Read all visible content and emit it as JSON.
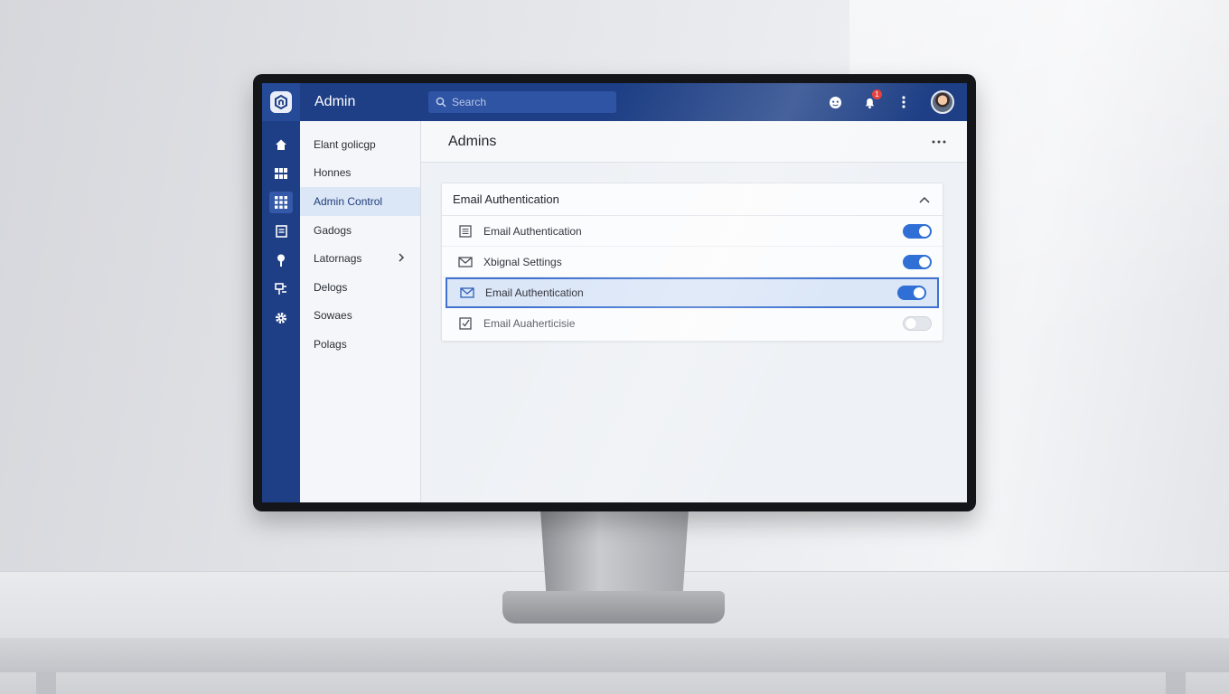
{
  "app": {
    "title": "Admin"
  },
  "search": {
    "placeholder": "Search"
  },
  "notifications": {
    "count": "1"
  },
  "colors": {
    "brand": "#1e3f85",
    "accent": "#2f6fd6"
  },
  "rail": {
    "items": [
      {
        "icon": "home-icon"
      },
      {
        "icon": "grid-icon"
      },
      {
        "icon": "apps-icon",
        "active": true
      },
      {
        "icon": "document-icon"
      },
      {
        "icon": "pin-icon"
      },
      {
        "icon": "tool-icon"
      },
      {
        "icon": "gear-icon"
      }
    ]
  },
  "nav": {
    "items": [
      {
        "label": "Elant golicgp"
      },
      {
        "label": "Honnes"
      },
      {
        "label": "Admin Control",
        "active": true
      },
      {
        "label": "Gadogs"
      },
      {
        "label": "Latornags",
        "has_submenu": true
      },
      {
        "label": "Delogs"
      },
      {
        "label": "Sowaes"
      },
      {
        "label": "Polags"
      }
    ]
  },
  "main": {
    "title": "Admins",
    "card": {
      "title": "Email Authentication",
      "rows": [
        {
          "label": "Email Authentication",
          "icon": "document-icon",
          "enabled": true
        },
        {
          "label": "Xbignal Settings",
          "icon": "mail-icon",
          "enabled": true
        },
        {
          "label": "Email Authentication",
          "icon": "mail-icon",
          "enabled": true,
          "selected": true
        },
        {
          "label": "Email Auaherticisie",
          "icon": "checkbox-icon",
          "enabled": false
        }
      ]
    }
  }
}
